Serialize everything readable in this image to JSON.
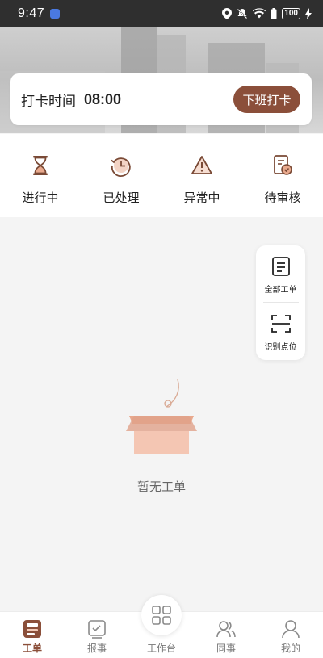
{
  "status_bar": {
    "time": "9:47",
    "battery": "100"
  },
  "clock_card": {
    "label": "打卡时间",
    "time": "08:00",
    "button": "下班打卡"
  },
  "status_items": [
    {
      "label": "进行中",
      "icon": "hourglass-icon"
    },
    {
      "label": "已处理",
      "icon": "history-icon"
    },
    {
      "label": "异常中",
      "icon": "warning-icon"
    },
    {
      "label": "待审核",
      "icon": "review-icon"
    }
  ],
  "side_panel": {
    "all_orders": "全部工单",
    "scan": "识别点位"
  },
  "empty_state": {
    "text": "暂无工单"
  },
  "bottom_nav": [
    {
      "label": "工单",
      "icon": "work-order-icon",
      "active": true
    },
    {
      "label": "报事",
      "icon": "report-icon",
      "active": false
    },
    {
      "label": "工作台",
      "icon": "workbench-icon",
      "active": false
    },
    {
      "label": "同事",
      "icon": "colleagues-icon",
      "active": false
    },
    {
      "label": "我的",
      "icon": "profile-icon",
      "active": false
    }
  ],
  "colors": {
    "accent": "#8b4f3a",
    "icon_brown": "#7a4a36",
    "box": "#e9a98d"
  }
}
